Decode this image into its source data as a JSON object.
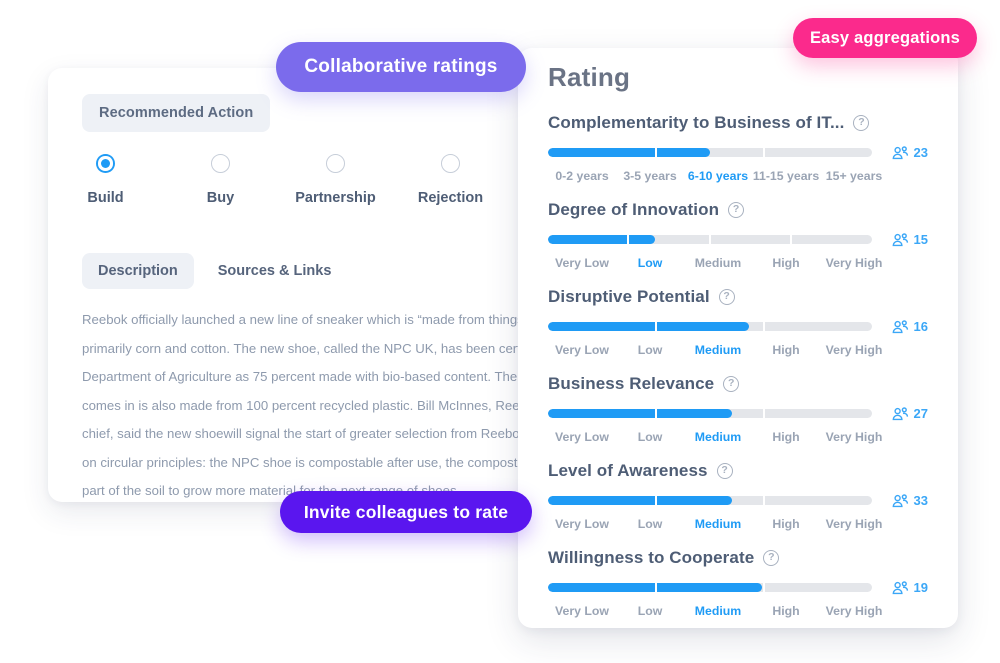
{
  "detail_card": {
    "recommended_action_chip": "Recommended Action",
    "options": [
      {
        "label": "Build",
        "selected": true
      },
      {
        "label": "Buy",
        "selected": false
      },
      {
        "label": "Partnership",
        "selected": false
      },
      {
        "label": "Rejection",
        "selected": false
      }
    ],
    "tabs": [
      {
        "label": "Description",
        "active": true
      },
      {
        "label": "Sources & Links",
        "active": false
      }
    ],
    "description": "Reebok officially launched a new line of sneaker which is “made from things that grow”, primarily corn and cotton. The new shoe, called the NPC UK, has been certified by the US Department of Agriculture as 75 percent made with bio-based content. The wrapping the shoe comes in is also made from 100 percent recycled plastic. Bill McInnes, Reebok’s innovation chief, said the new shoewill signal the start of greater selection from Reebok that will be based on circular principles: the NPC shoe is compostable after use, the compost will then be used as part of the soil to grow more material for the next range of shoes."
  },
  "rating_card": {
    "title": "Rating",
    "help_icon_glyph": "?",
    "voters_icon": "group-icon",
    "rows": [
      {
        "name": "Complementarity to Business of IT...",
        "voters": "23",
        "fill_percent": 50,
        "segments": 3,
        "scale": [
          "0-2 years",
          "3-5 years",
          "6-10 years",
          "11-15 years",
          "15+ years"
        ],
        "selected_index": 2
      },
      {
        "name": "Degree of Innovation",
        "voters": "15",
        "fill_percent": 33,
        "segments": 4,
        "scale": [
          "Very Low",
          "Low",
          "Medium",
          "High",
          "Very High"
        ],
        "selected_index": 1
      },
      {
        "name": "Disruptive Potential",
        "voters": "16",
        "fill_percent": 62,
        "segments": 3,
        "scale": [
          "Very Low",
          "Low",
          "Medium",
          "High",
          "Very High"
        ],
        "selected_index": 2
      },
      {
        "name": "Business Relevance",
        "voters": "27",
        "fill_percent": 57,
        "segments": 3,
        "scale": [
          "Very Low",
          "Low",
          "Medium",
          "High",
          "Very High"
        ],
        "selected_index": 2
      },
      {
        "name": "Level of Awareness",
        "voters": "33",
        "fill_percent": 57,
        "segments": 3,
        "scale": [
          "Very Low",
          "Low",
          "Medium",
          "High",
          "Very High"
        ],
        "selected_index": 2
      },
      {
        "name": "Willingness to Cooperate",
        "voters": "19",
        "fill_percent": 66,
        "segments": 3,
        "scale": [
          "Very Low",
          "Low",
          "Medium",
          "High",
          "Very High"
        ],
        "selected_index": 2
      }
    ]
  },
  "pills": [
    {
      "id": "collaborative",
      "label": "Collaborative ratings",
      "color": "#7b6bec"
    },
    {
      "id": "aggregations",
      "label": "Easy aggregations",
      "color": "#fb2a8c"
    },
    {
      "id": "invite",
      "label": "Invite colleagues to rate",
      "color": "#5a16ef"
    }
  ],
  "colors": {
    "accent_blue": "#1f9bf5",
    "track_grey": "#e4e6ea",
    "text_dark": "#4e5d75",
    "text_muted": "#9aa4b4"
  }
}
